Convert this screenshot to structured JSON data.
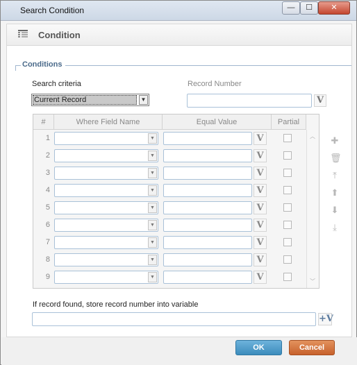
{
  "window": {
    "title": "Search Condition",
    "min_label": "—",
    "max_label": "☐",
    "close_label": "✕"
  },
  "header": {
    "title": "Condition"
  },
  "section": {
    "legend": "Conditions"
  },
  "search": {
    "label": "Search criteria",
    "selected": "Current Record"
  },
  "record_number": {
    "label": "Record Number",
    "value": ""
  },
  "grid": {
    "columns": [
      "#",
      "Where Field Name",
      "Equal Value",
      "Partial"
    ],
    "rows": [
      {
        "num": "1"
      },
      {
        "num": "2"
      },
      {
        "num": "3"
      },
      {
        "num": "4"
      },
      {
        "num": "5"
      },
      {
        "num": "6"
      },
      {
        "num": "7"
      },
      {
        "num": "8"
      },
      {
        "num": "9"
      }
    ]
  },
  "variable_button": "V",
  "store": {
    "label": "If record found, store record number into variable",
    "value": ""
  },
  "buttons": {
    "ok": "OK",
    "cancel": "Cancel"
  }
}
